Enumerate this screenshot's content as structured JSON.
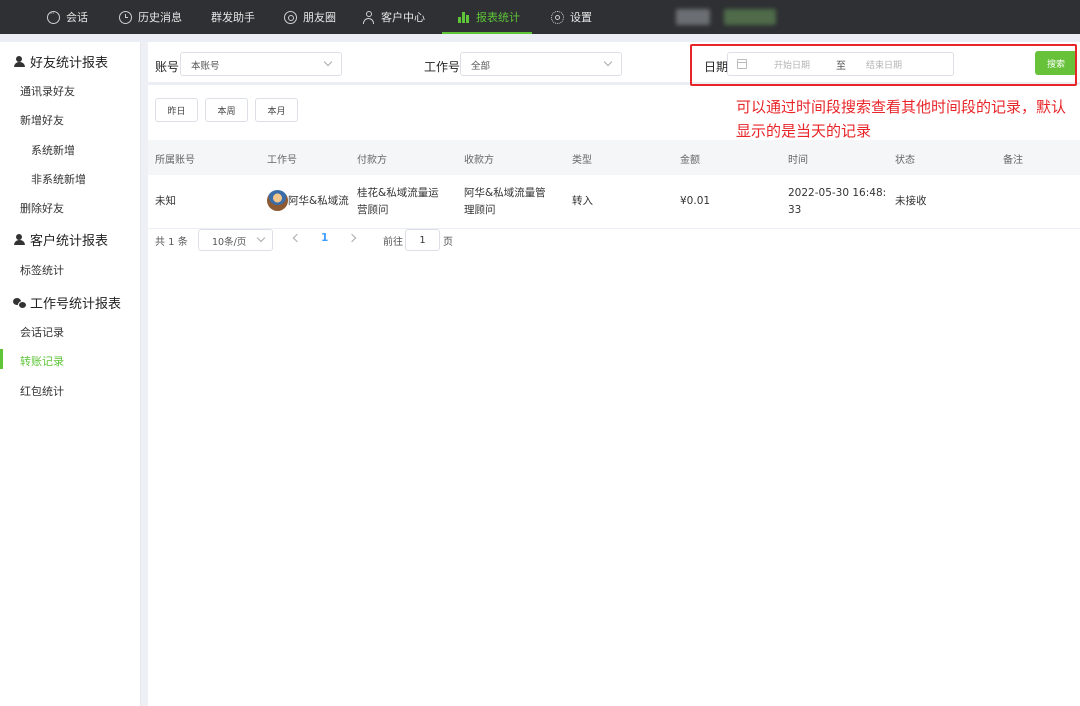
{
  "nav": {
    "items": [
      {
        "label": "会话",
        "icon": "chat-icon"
      },
      {
        "label": "历史消息",
        "icon": "clock-icon"
      },
      {
        "label": "群发助手",
        "icon": ""
      },
      {
        "label": "朋友圈",
        "icon": "moments-icon"
      },
      {
        "label": "客户中心",
        "icon": "user-icon"
      },
      {
        "label": "报表统计",
        "icon": "bar-chart-icon",
        "active": true
      },
      {
        "label": "设置",
        "icon": "gear-icon"
      }
    ],
    "accent": "#5ec538"
  },
  "sidebar": {
    "sections": [
      {
        "title": "好友统计报表",
        "icon": "person-icon",
        "items": [
          "通讯录好友",
          "新增好友",
          "系统新增",
          "非系统新增",
          "删除好友"
        ]
      },
      {
        "title": "客户统计报表",
        "icon": "person-icon",
        "items": [
          "标签统计"
        ]
      },
      {
        "title": "工作号统计报表",
        "icon": "wechat-icon",
        "items": [
          "会话记录",
          "转账记录",
          "红包统计"
        ]
      }
    ],
    "active_item": "转账记录"
  },
  "filters": {
    "account_label": "账号",
    "account_value": "本账号",
    "worknum_label": "工作号",
    "worknum_value": "全部",
    "date_label": "日期",
    "date_start_placeholder": "开始日期",
    "date_separator": "至",
    "date_end_placeholder": "结束日期",
    "search_label": "搜索"
  },
  "annotation": "可以通过时间段搜索查看其他时间段的记录，默认显示的是当天的记录",
  "quick_range": [
    "昨日",
    "本周",
    "本月"
  ],
  "table": {
    "columns": [
      "所属账号",
      "工作号",
      "付款方",
      "收款方",
      "类型",
      "金额",
      "时间",
      "状态",
      "备注"
    ],
    "rows": [
      {
        "account": "未知",
        "worknum": "阿华&私域流",
        "payer_line1": "桂花&私域流量运",
        "payer_line2": "营顾问",
        "payee_line1": "阿华&私域流量管",
        "payee_line2": "理顾问",
        "type": "转入",
        "amount": "¥0.01",
        "time_line1": "2022-05-30 16:48:",
        "time_line2": "33",
        "status": "未接收",
        "note": ""
      }
    ]
  },
  "pagination": {
    "total": "共 1 条",
    "page_size": "10条/页",
    "current_page": "1",
    "goto_label": "前往",
    "goto_value": "1",
    "page_suffix": "页"
  }
}
